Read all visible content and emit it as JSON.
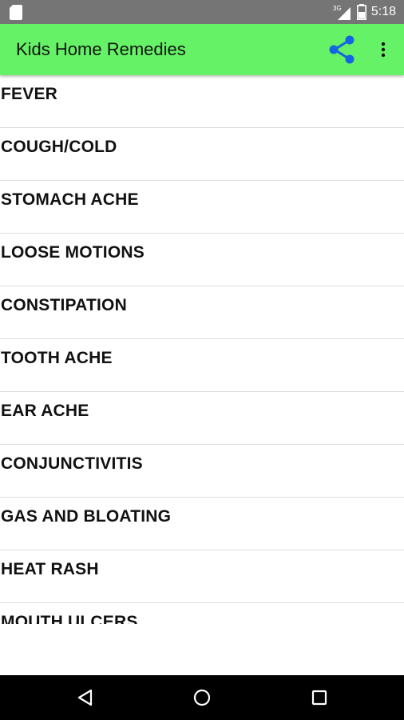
{
  "status_bar": {
    "time": "5:18",
    "network_label": "3G",
    "icons": [
      "sd-card-icon",
      "signal-icon",
      "battery-icon"
    ]
  },
  "app_bar": {
    "title": "Kids Home Remedies",
    "background_color": "#66f266",
    "share_icon_color": "#1565e0",
    "icons": [
      "share-icon",
      "overflow-menu-icon"
    ]
  },
  "remedies": {
    "items": [
      {
        "label": "FEVER"
      },
      {
        "label": "COUGH/COLD"
      },
      {
        "label": "STOMACH ACHE"
      },
      {
        "label": "LOOSE MOTIONS"
      },
      {
        "label": "CONSTIPATION"
      },
      {
        "label": "TOOTH ACHE"
      },
      {
        "label": "EAR ACHE"
      },
      {
        "label": "CONJUNCTIVITIS"
      },
      {
        "label": "GAS AND BLOATING"
      },
      {
        "label": "HEAT RASH"
      },
      {
        "label": "MOUTH ULCERS"
      }
    ]
  },
  "nav_bar": {
    "icons": [
      "back-icon",
      "home-icon",
      "recents-icon"
    ]
  }
}
